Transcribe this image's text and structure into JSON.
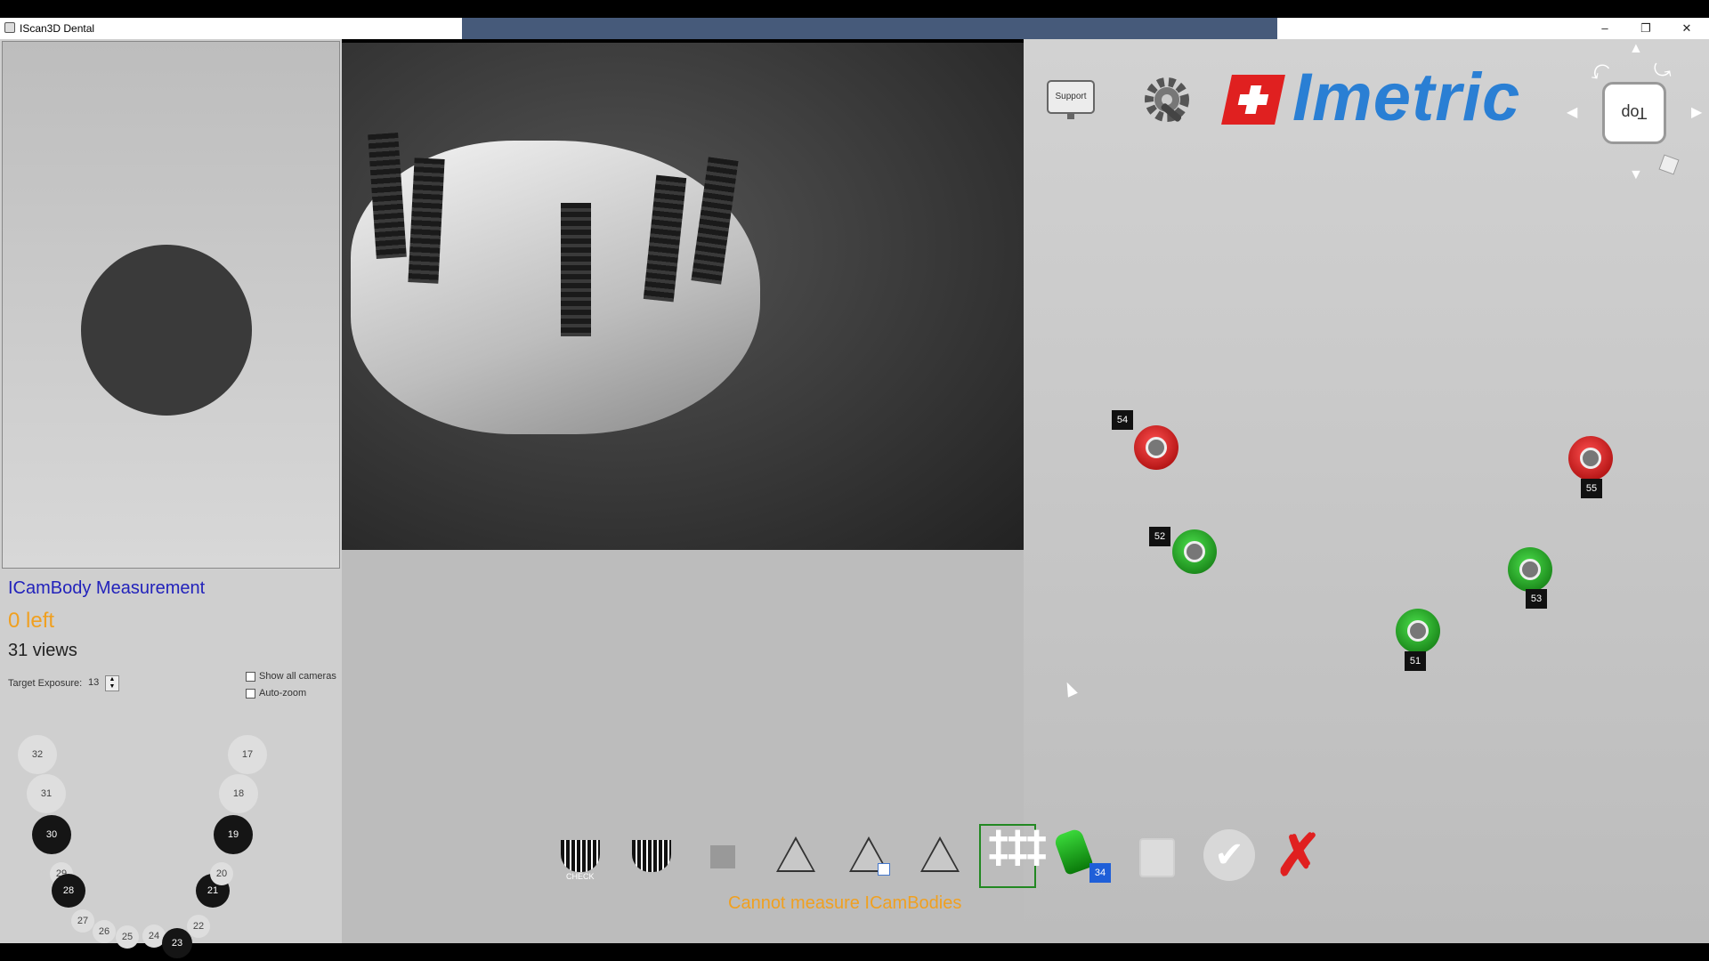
{
  "window": {
    "title": "IScan3D Dental",
    "minimize": "–",
    "restore": "❐",
    "close": "✕"
  },
  "left_panel": {
    "measurement_title": "ICamBody Measurement",
    "remaining": "0 left",
    "views": "31 views",
    "exposure_label": "Target Exposure:",
    "exposure_value": "13",
    "show_all_cameras": "Show all cameras",
    "auto_zoom": "Auto-zoom",
    "teeth": [
      "32",
      "31",
      "30",
      "29",
      "28",
      "27",
      "26",
      "25",
      "24",
      "23",
      "22",
      "21",
      "20",
      "19",
      "18",
      "17"
    ]
  },
  "header": {
    "support_label": "Support",
    "logo_text": "Imetric",
    "logo_color": "#2a7fd4",
    "logo_cross_color": "#e02020"
  },
  "navcube": {
    "label": "Top"
  },
  "markers": [
    {
      "id": "54",
      "color": "red"
    },
    {
      "id": "55",
      "color": "red"
    },
    {
      "id": "52",
      "color": "green"
    },
    {
      "id": "53",
      "color": "green"
    },
    {
      "id": "51",
      "color": "green"
    }
  ],
  "toolbar": {
    "check_label": "CHECK",
    "bodies_count": "34",
    "status_message": "Cannot measure ICamBodies",
    "status_color": "#f0a020"
  },
  "icons": [
    "support-icon",
    "settings-icon",
    "check-grid-icon",
    "grid-icon",
    "stop-icon",
    "triangle-icon",
    "triangle-save-icon",
    "triangle-posts-icon",
    "multi-triangle-icon",
    "icambody-icon",
    "trash-icon",
    "confirm-icon",
    "cancel-icon"
  ]
}
